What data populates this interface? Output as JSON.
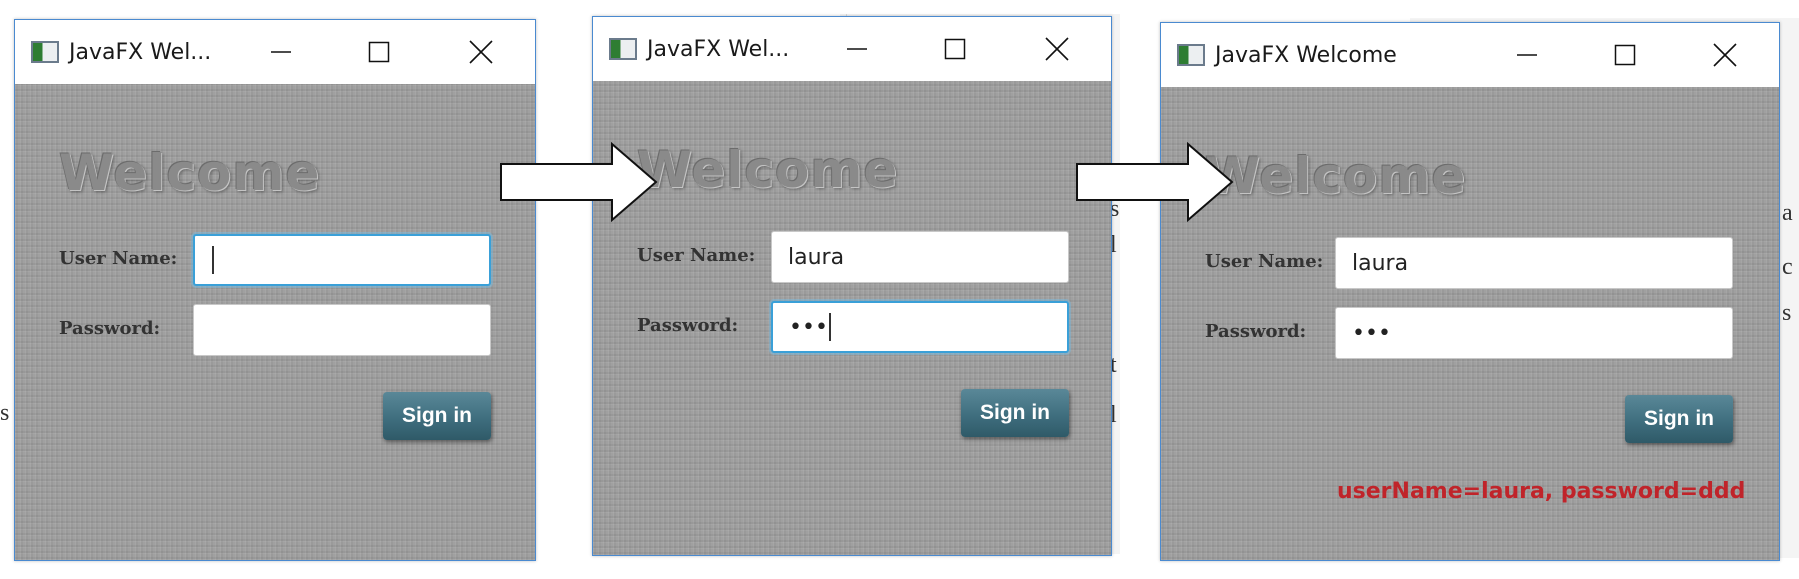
{
  "windows": [
    {
      "title": "JavaFX Wel...",
      "welcome": "Welcome",
      "username_label": "User Name:",
      "username_value": "",
      "password_label": "Password:",
      "password_value": "",
      "signin_label": "Sign in",
      "message": ""
    },
    {
      "title": "JavaFX Wel...",
      "welcome": "Welcome",
      "username_label": "User Name:",
      "username_value": "laura",
      "password_label": "Password:",
      "password_value": "•••",
      "signin_label": "Sign in",
      "message": ""
    },
    {
      "title": "JavaFX Welcome",
      "welcome": "Welcome",
      "username_label": "User Name:",
      "username_value": "laura",
      "password_label": "Password:",
      "password_value": "•••",
      "signin_label": "Sign in",
      "message": "userName=laura, password=ddd"
    }
  ],
  "background_fragments": [
    "s",
    "l",
    "t",
    "l",
    "s",
    "a",
    "c",
    "s"
  ],
  "colors": {
    "focus_border": "#3aa0d8",
    "message_red": "#c0242a",
    "window_border": "#4a8ad0",
    "button_teal": "#3f6e7e"
  },
  "icons": [
    "app-icon",
    "minimize-icon",
    "maximize-icon",
    "close-icon",
    "right-arrow-icon"
  ]
}
